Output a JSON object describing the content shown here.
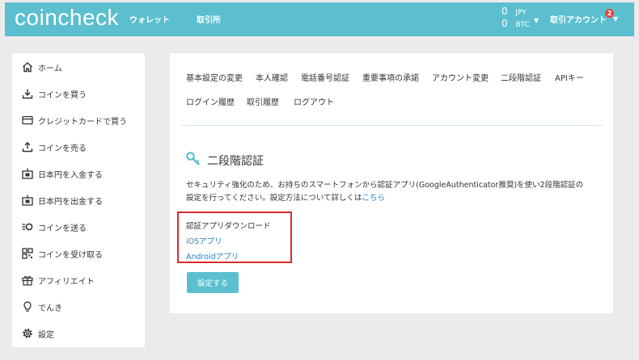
{
  "header": {
    "logo": "coincheck",
    "nav": [
      {
        "label": "ウォレット"
      },
      {
        "label": "取引所"
      }
    ],
    "balances": [
      {
        "amount": "0",
        "currency": "JPY"
      },
      {
        "amount": "0",
        "currency": "BTC"
      }
    ],
    "account_label": "取引アカウント",
    "notification_count": "2"
  },
  "sidebar": {
    "items": [
      {
        "label": "ホーム",
        "icon": "home-icon"
      },
      {
        "label": "コインを買う",
        "icon": "download-icon"
      },
      {
        "label": "クレジットカードで買う",
        "icon": "credit-card-icon"
      },
      {
        "label": "コインを売る",
        "icon": "upload-icon"
      },
      {
        "label": "日本円を入金する",
        "icon": "bank-deposit-icon"
      },
      {
        "label": "日本円を出金する",
        "icon": "bank-withdraw-icon"
      },
      {
        "label": "コインを送る",
        "icon": "send-icon"
      },
      {
        "label": "コインを受け取る",
        "icon": "qr-code-icon"
      },
      {
        "label": "アフィリエイト",
        "icon": "gift-icon"
      },
      {
        "label": "でんき",
        "icon": "lightbulb-icon"
      },
      {
        "label": "設定",
        "icon": "gear-icon"
      }
    ]
  },
  "main": {
    "tabs": [
      {
        "label": "基本設定の変更"
      },
      {
        "label": "本人確認"
      },
      {
        "label": "電話番号認証"
      },
      {
        "label": "重要事項の承諾"
      },
      {
        "label": "アカウント変更"
      },
      {
        "label": "二段階認証"
      },
      {
        "label": "APIキー"
      },
      {
        "label": "ログイン履歴"
      },
      {
        "label": "取引履歴"
      },
      {
        "label": "ログアウト"
      }
    ],
    "section_title": "二段階認証",
    "description_line1": "セキュリティ強化のため、お持ちのスマートフォンから認証アプリ(GoogleAuthenticator推奨)を使い2段階認証の",
    "description_line2": "設定を行ってください。設定方法について詳しくは",
    "description_link": "こちら",
    "download_title": "認証アプリダウンロード",
    "ios_link": "iOSアプリ",
    "android_link": "Androidアプリ",
    "setup_button": "設定する"
  },
  "colors": {
    "brand": "#5bbfcf",
    "link": "#2d82c4",
    "highlight": "#d92b2b"
  }
}
